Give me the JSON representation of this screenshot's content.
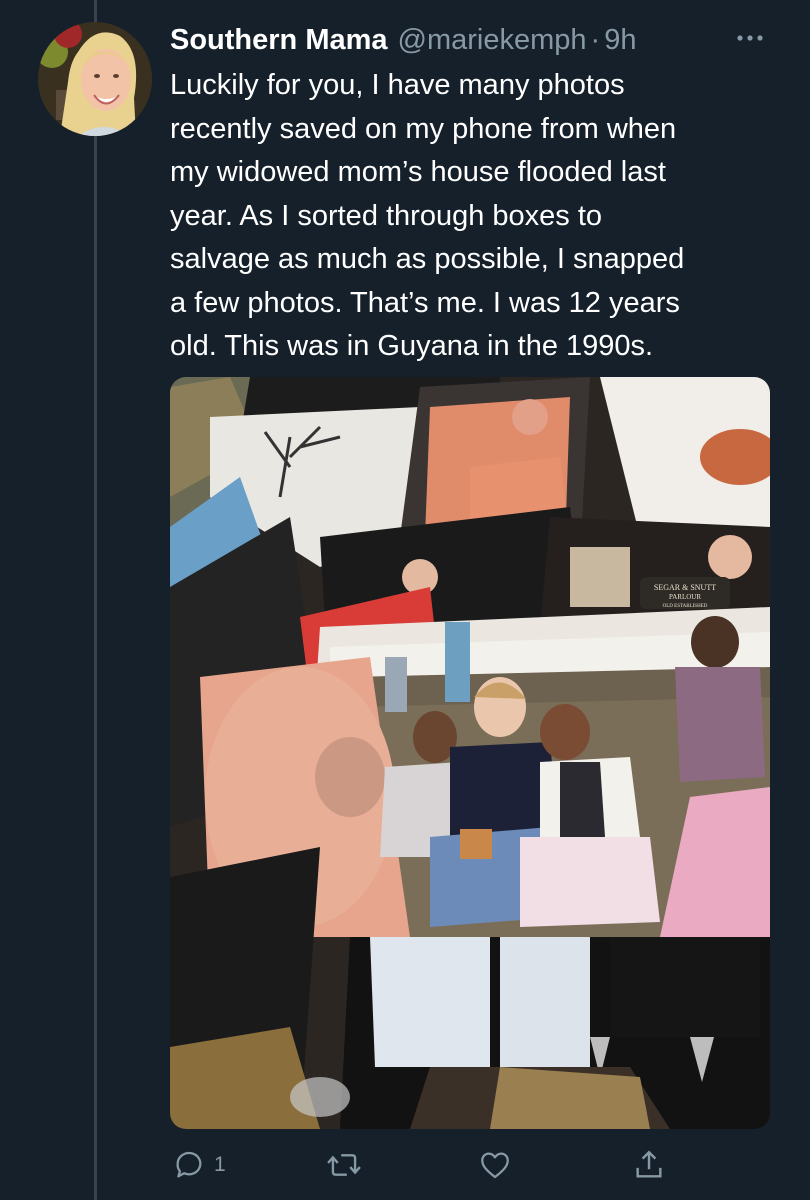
{
  "tweet": {
    "author": {
      "display_name": "Southern Mama",
      "handle": "@mariekemph",
      "separator": "·",
      "time": "9h"
    },
    "text_lines": [
      "Luckily for you, I have many photos",
      "recently saved on my phone from when",
      "my widowed mom’s house flooded last",
      "year. As I sorted through boxes to",
      "salvage as much as possible, I snapped",
      "a few photos. That’s me. I was 12 years",
      "old. This was in Guyana in the 1990s."
    ],
    "media": {
      "sign_line_1": "SEGAR & SNUTT",
      "sign_line_2": "PARLOUR",
      "sign_line_3": "OLD ESTABLISHED"
    },
    "actions": {
      "reply_count": "1",
      "icons": [
        "reply-icon",
        "retweet-icon",
        "like-icon",
        "share-icon"
      ]
    }
  },
  "colors": {
    "background": "#15202b",
    "text_primary": "#ffffff",
    "text_secondary": "#8899a6",
    "thread_line": "#38444d"
  }
}
